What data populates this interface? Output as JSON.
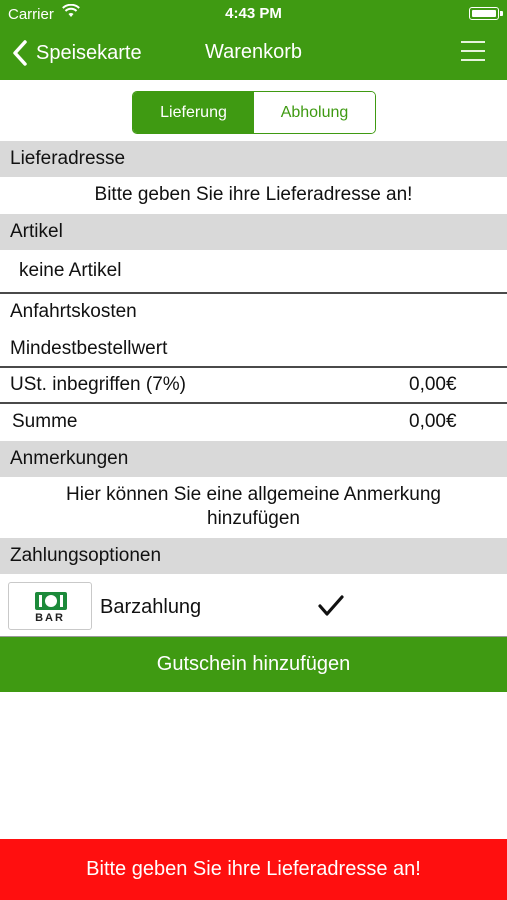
{
  "status_bar": {
    "carrier": "Carrier",
    "time": "4:43 PM"
  },
  "nav": {
    "back_label": "Speisekarte",
    "title": "Warenkorb",
    "icons": [
      "chevron-left-icon",
      "hamburger-menu-icon"
    ]
  },
  "segment": {
    "options": [
      "Lieferung",
      "Abholung"
    ],
    "selected": "Lieferung"
  },
  "delivery_address": {
    "header": "Lieferadresse",
    "prompt": "Bitte geben Sie ihre Lieferadresse an!"
  },
  "articles": {
    "header": "Artikel",
    "empty_text": "keine Artikel"
  },
  "costs": {
    "travel_costs_label": "Anfahrtskosten",
    "minimum_order_label": "Mindestbestellwert",
    "vat_label": "USt. inbegriffen (7%)",
    "vat_value": "0,00€",
    "sum_label": "Summe",
    "sum_value": "0,00€"
  },
  "notes": {
    "header": "Anmerkungen",
    "prompt_line1": "Hier können Sie eine allgemeine Anmerkung",
    "prompt_line2": "hinzufügen"
  },
  "payment": {
    "header": "Zahlungsoptionen",
    "icon_text": "BAR",
    "option_label": "Barzahlung",
    "selected": true
  },
  "voucher_button": "Gutschein hinzufügen",
  "footer_message": "Bitte geben Sie ihre Lieferadresse an!",
  "colors": {
    "primary_green": "#3f9a12",
    "section_gray": "#d9d9d9",
    "alert_red": "#ff0f0f"
  }
}
